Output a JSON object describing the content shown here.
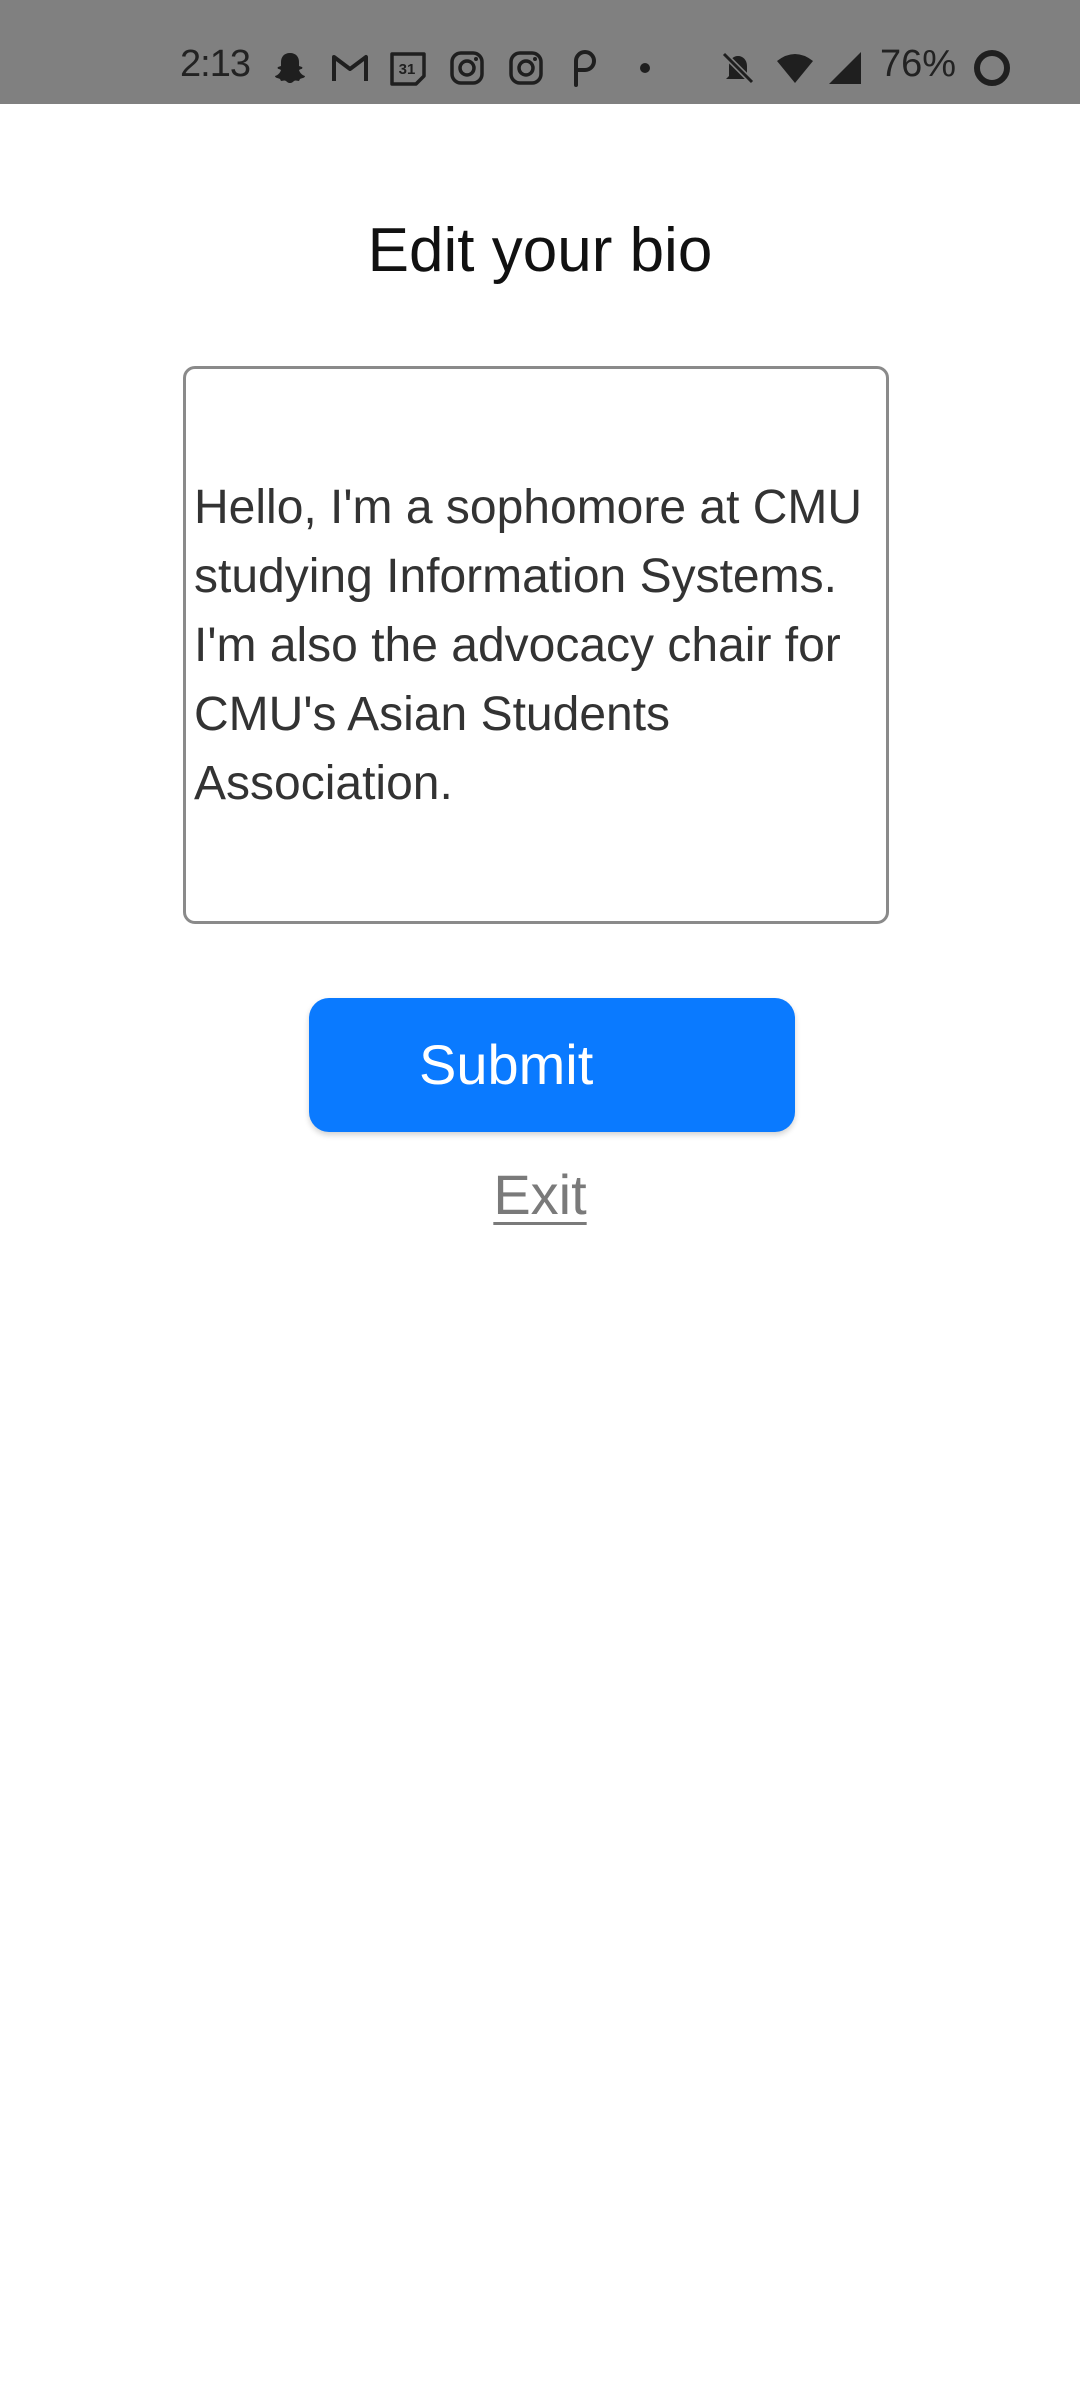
{
  "status_bar": {
    "time": "2:13",
    "battery_percent": "76%",
    "notification_icons": [
      "snapchat-icon",
      "gmail-icon",
      "calendar-icon",
      "instagram-icon",
      "instagram-icon",
      "pinterest-icon",
      "dot-icon"
    ],
    "calendar_day": "31",
    "system_icons": [
      "bell-muted-icon",
      "wifi-icon",
      "signal-icon",
      "battery-icon"
    ]
  },
  "page": {
    "title": "Edit your bio"
  },
  "bio": {
    "value": "Hello, I'm a sophomore at CMU\nstudying Information Systems.\nI'm also the advocacy chair for\nCMU's Asian Students\nAssociation."
  },
  "actions": {
    "submit_label": "Submit",
    "exit_label": "Exit"
  },
  "colors": {
    "status_bar_bg": "#808080",
    "submit_bg": "#0a7aff",
    "submit_text": "#ffffff",
    "exit_text": "#7a7a7a",
    "input_border": "#8a8a8a"
  }
}
